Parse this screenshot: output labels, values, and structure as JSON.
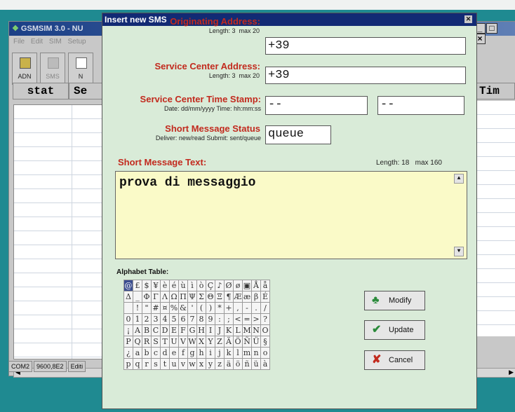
{
  "background_app": {
    "title": "GSMSIM 3.0 - NU",
    "menu": [
      "File",
      "Edit",
      "SIM",
      "Setup"
    ],
    "toolbar": [
      {
        "label": "ADN",
        "icon": "folder-icon"
      },
      {
        "label": "SMS",
        "icon": "sms-icon"
      },
      {
        "label": "N",
        "icon": "doc-icon"
      }
    ],
    "columns": [
      "stat",
      "Se",
      "Tim"
    ],
    "status_bar": [
      "COM2",
      "9600,8E2",
      "Editi"
    ]
  },
  "dialog": {
    "title": "Insert new SMS",
    "originating": {
      "label": "Originating Address:",
      "length": "Length: 3",
      "max": "max 20",
      "value": "+39"
    },
    "service_center": {
      "label": "Service Center Address:",
      "length": "Length: 3",
      "max": "max 20",
      "value": "+39"
    },
    "timestamp": {
      "label": "Service Center Time Stamp:",
      "hint": "Date: dd/mm/yyyy  Time: hh:mm:ss",
      "date_value": "--",
      "time_value": "--"
    },
    "status": {
      "label": "Short Message Status",
      "hint": "Deliver: new/read  Submit: sent/queue",
      "value": "queue"
    },
    "message": {
      "label": "Short Message Text:",
      "length": "Length: 18",
      "max": "max 160",
      "value": "prova di messaggio"
    },
    "alphabet_label": "Alphabet Table:",
    "alphabet_rows": [
      [
        "@",
        "£",
        "$",
        "¥",
        "è",
        "é",
        "ù",
        "ì",
        "ò",
        "Ç",
        "♪",
        "Ø",
        "ø",
        "▣",
        "Å",
        "å"
      ],
      [
        "Δ",
        "_",
        "Φ",
        "Γ",
        "Λ",
        "Ω",
        "Π",
        "Ψ",
        "Σ",
        "Θ",
        "Ξ",
        "¶",
        "Æ",
        "æ",
        "β",
        "É"
      ],
      [
        " ",
        "!",
        "\"",
        "#",
        "¤",
        "%",
        "&",
        "'",
        "(",
        ")",
        "*",
        "+",
        ",",
        "-",
        ".",
        "/"
      ],
      [
        "0",
        "1",
        "2",
        "3",
        "4",
        "5",
        "6",
        "7",
        "8",
        "9",
        ":",
        ";",
        "<",
        "=",
        ">",
        "?"
      ],
      [
        "¡",
        "A",
        "B",
        "C",
        "D",
        "E",
        "F",
        "G",
        "H",
        "I",
        "J",
        "K",
        "L",
        "M",
        "N",
        "O"
      ],
      [
        "P",
        "Q",
        "R",
        "S",
        "T",
        "U",
        "V",
        "W",
        "X",
        "Y",
        "Z",
        "Ä",
        "Ö",
        "Ñ",
        "Ü",
        "§"
      ],
      [
        "¿",
        "a",
        "b",
        "c",
        "d",
        "e",
        "f",
        "g",
        "h",
        "i",
        "j",
        "k",
        "l",
        "m",
        "n",
        "o"
      ],
      [
        "p",
        "q",
        "r",
        "s",
        "t",
        "u",
        "v",
        "w",
        "x",
        "y",
        "z",
        "ä",
        "ö",
        "ñ",
        "ü",
        "à"
      ]
    ],
    "buttons": {
      "modify": "Modify",
      "update": "Update",
      "cancel": "Cancel"
    },
    "colors": {
      "label_red": "#c22a1e",
      "textarea_bg": "#fafac8",
      "dialog_bg": "#d9ebd8",
      "title_bar": "#122a74"
    }
  }
}
